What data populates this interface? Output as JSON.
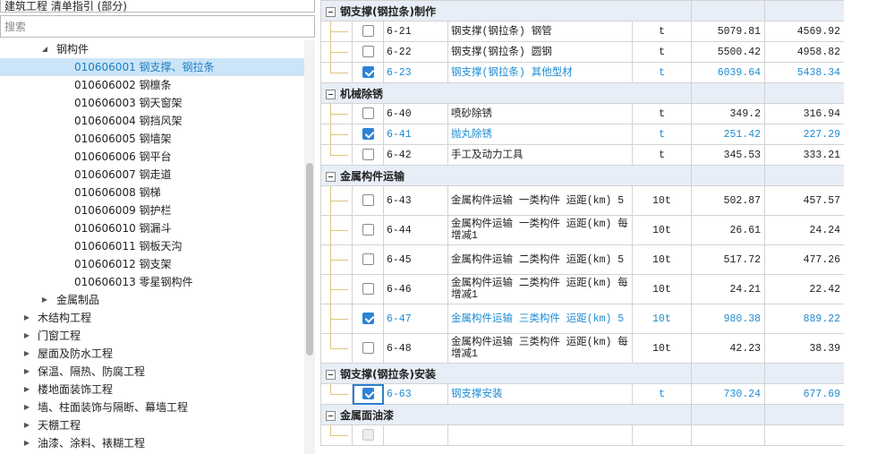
{
  "left": {
    "top_field_value": "建筑工程 清单指引 (部分)",
    "search": {
      "placeholder": "搜索",
      "value": ""
    },
    "tree": [
      {
        "label": "钢构件",
        "arrow": "◢",
        "level": 1,
        "selected": false,
        "expanded": true
      },
      {
        "label": "010606001  钢支撑、钢拉条",
        "arrow": "",
        "level": 2,
        "selected": true
      },
      {
        "label": "010606002  钢檩条",
        "arrow": "",
        "level": 2,
        "selected": false
      },
      {
        "label": "010606003  钢天窗架",
        "arrow": "",
        "level": 2,
        "selected": false
      },
      {
        "label": "010606004  钢挡风架",
        "arrow": "",
        "level": 2,
        "selected": false
      },
      {
        "label": "010606005  钢墙架",
        "arrow": "",
        "level": 2,
        "selected": false
      },
      {
        "label": "010606006  钢平台",
        "arrow": "",
        "level": 2,
        "selected": false
      },
      {
        "label": "010606007  钢走道",
        "arrow": "",
        "level": 2,
        "selected": false
      },
      {
        "label": "010606008  钢梯",
        "arrow": "",
        "level": 2,
        "selected": false
      },
      {
        "label": "010606009  钢护栏",
        "arrow": "",
        "level": 2,
        "selected": false
      },
      {
        "label": "010606010  钢漏斗",
        "arrow": "",
        "level": 2,
        "selected": false
      },
      {
        "label": "010606011  钢板天沟",
        "arrow": "",
        "level": 2,
        "selected": false
      },
      {
        "label": "010606012  钢支架",
        "arrow": "",
        "level": 2,
        "selected": false
      },
      {
        "label": "010606013  零星钢构件",
        "arrow": "",
        "level": 2,
        "selected": false
      },
      {
        "label": "金属制品",
        "arrow": "▶",
        "level": 1,
        "selected": false,
        "expanded": false
      },
      {
        "label": "木结构工程",
        "arrow": "▶",
        "level": 0,
        "selected": false,
        "expanded": false
      },
      {
        "label": "门窗工程",
        "arrow": "▶",
        "level": 0,
        "selected": false,
        "expanded": false
      },
      {
        "label": "屋面及防水工程",
        "arrow": "▶",
        "level": 0,
        "selected": false,
        "expanded": false
      },
      {
        "label": "保温、隔热、防腐工程",
        "arrow": "▶",
        "level": 0,
        "selected": false,
        "expanded": false
      },
      {
        "label": "楼地面装饰工程",
        "arrow": "▶",
        "level": 0,
        "selected": false,
        "expanded": false
      },
      {
        "label": "墙、柱面装饰与隔断、幕墙工程",
        "arrow": "▶",
        "level": 0,
        "selected": false,
        "expanded": false
      },
      {
        "label": "天棚工程",
        "arrow": "▶",
        "level": 0,
        "selected": false,
        "expanded": false
      },
      {
        "label": "油漆、涂料、裱糊工程",
        "arrow": "▶",
        "level": 0,
        "selected": false,
        "expanded": false
      }
    ]
  },
  "grid": {
    "colors": {
      "highlight_text": "#1f8bd0",
      "checkbox_on": "#2c83d4",
      "group_bg": "#e7eef7"
    },
    "groups": [
      {
        "title": "钢支撑(钢拉条)制作",
        "rows": [
          {
            "code": "6-21",
            "name": "钢支撑(钢拉条) 钢管",
            "unit": "t",
            "price1": "5079.81",
            "price2": "4569.92",
            "checked": false,
            "highlight": false
          },
          {
            "code": "6-22",
            "name": "钢支撑(钢拉条) 圆钢",
            "unit": "t",
            "price1": "5500.42",
            "price2": "4958.82",
            "checked": false,
            "highlight": false
          },
          {
            "code": "6-23",
            "name": "钢支撑(钢拉条) 其他型材",
            "unit": "t",
            "price1": "6039.64",
            "price2": "5438.34",
            "checked": true,
            "highlight": true
          }
        ]
      },
      {
        "title": "机械除锈",
        "rows": [
          {
            "code": "6-40",
            "name": "喷砂除锈",
            "unit": "t",
            "price1": "349.2",
            "price2": "316.94",
            "checked": false,
            "highlight": false
          },
          {
            "code": "6-41",
            "name": "抛丸除锈",
            "unit": "t",
            "price1": "251.42",
            "price2": "227.29",
            "checked": true,
            "highlight": true
          },
          {
            "code": "6-42",
            "name": "手工及动力工具",
            "unit": "t",
            "price1": "345.53",
            "price2": "333.21",
            "checked": false,
            "highlight": false
          }
        ]
      },
      {
        "title": "金属构件运输",
        "rows": [
          {
            "code": "6-43",
            "name": "金属构件运输 一类构件 运距(km) 5",
            "unit": "10t",
            "price1": "502.87",
            "price2": "457.57",
            "checked": false,
            "highlight": false,
            "tall": true
          },
          {
            "code": "6-44",
            "name": "金属构件运输 一类构件 运距(km) 每增减1",
            "unit": "10t",
            "price1": "26.61",
            "price2": "24.24",
            "checked": false,
            "highlight": false,
            "tall": true
          },
          {
            "code": "6-45",
            "name": "金属构件运输 二类构件 运距(km) 5",
            "unit": "10t",
            "price1": "517.72",
            "price2": "477.26",
            "checked": false,
            "highlight": false,
            "tall": true
          },
          {
            "code": "6-46",
            "name": "金属构件运输 二类构件 运距(km) 每增减1",
            "unit": "10t",
            "price1": "24.21",
            "price2": "22.42",
            "checked": false,
            "highlight": false,
            "tall": true
          },
          {
            "code": "6-47",
            "name": "金属构件运输 三类构件 运距(km) 5",
            "unit": "10t",
            "price1": "980.38",
            "price2": "889.22",
            "checked": true,
            "highlight": true,
            "tall": true
          },
          {
            "code": "6-48",
            "name": "金属构件运输 三类构件 运距(km) 每增减1",
            "unit": "10t",
            "price1": "42.23",
            "price2": "38.39",
            "checked": false,
            "highlight": false,
            "tall": true
          }
        ]
      },
      {
        "title": "钢支撑(钢拉条)安装",
        "rows": [
          {
            "code": "6-63",
            "name": "钢支撑安装",
            "unit": "t",
            "price1": "730.24",
            "price2": "677.69",
            "checked": true,
            "highlight": true,
            "focused": true
          }
        ]
      },
      {
        "title": "金属面油漆",
        "rows": [
          {
            "code": "",
            "name": "",
            "unit": "",
            "price1": "",
            "price2": "",
            "checked": false,
            "highlight": false,
            "disabled": true
          }
        ]
      }
    ]
  }
}
